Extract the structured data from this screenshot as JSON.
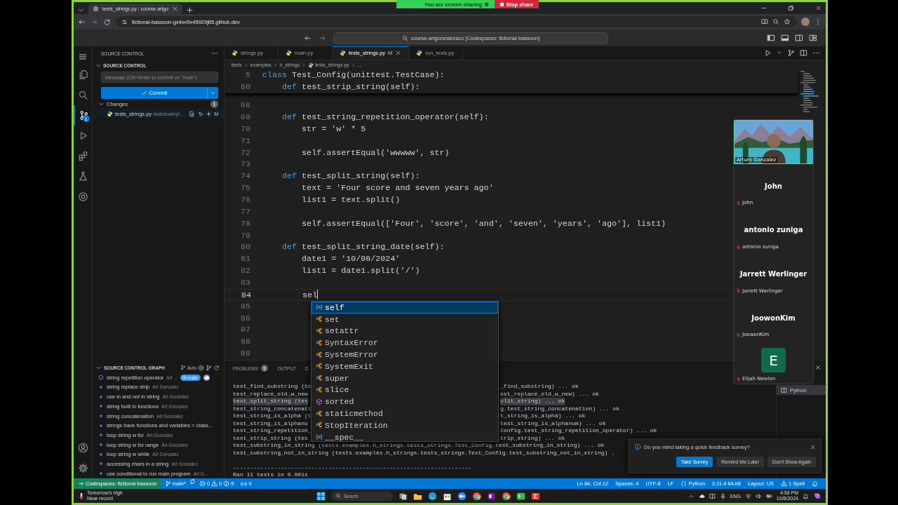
{
  "browser": {
    "tab_title": "tests_strings.py - course-artgo",
    "address": "fictional-bassoon-gx4xv9x45929j65.github.dev"
  },
  "share_bar": {
    "status": "You are screen sharing",
    "stop": "Stop share"
  },
  "title_bar": {
    "command_center": "course-artgonzalezacc [Codespaces: fictional bassoon]"
  },
  "activity_bar": {
    "items": [
      {
        "kind": "files",
        "selected": false
      },
      {
        "kind": "search",
        "selected": false
      },
      {
        "kind": "scm",
        "selected": true,
        "badge": "1"
      },
      {
        "kind": "run",
        "selected": false
      },
      {
        "kind": "extensions",
        "selected": false
      },
      {
        "kind": "testing",
        "selected": false
      },
      {
        "kind": "remote",
        "selected": false
      }
    ]
  },
  "sidebar": {
    "title": "SOURCE CONTROL",
    "section": {
      "label": "SOURCE CONTROL",
      "expanded": true
    },
    "message_placeholder": "Message (Ctrl+Enter to commit on \"main\")",
    "commit": "Commit",
    "changes": {
      "label": "Changes",
      "count": "1",
      "expanded": true,
      "files": [
        {
          "name": "tests_strings.py",
          "path": "tests/exampl...",
          "status": "M"
        }
      ]
    },
    "graph": {
      "label": "SOURCE CONTROL GRAPH",
      "expanded": true,
      "mode": "Auto",
      "commits": [
        {
          "message": "string repetition operator",
          "author": "Art ...",
          "branch": "main",
          "current": true
        },
        {
          "message": "string replace strip",
          "author": "Art Gonzalez",
          "current": false
        },
        {
          "message": "use in and not in string",
          "author": "Art Gonzalez",
          "current": false
        },
        {
          "message": "string built in functions",
          "author": "Art Gonzalez",
          "current": false
        },
        {
          "message": "string concatenation",
          "author": "Art Gonzalez",
          "current": false
        },
        {
          "message": "strings have functions and variables = class...",
          "current": false
        },
        {
          "message": "loop string w for",
          "author": "Art Gonzalez",
          "current": false
        },
        {
          "message": "loop string w for range",
          "author": "Art Gonzalez",
          "current": false
        },
        {
          "message": "loop string w while",
          "author": "Art Gonzalez",
          "current": false
        },
        {
          "message": "accessing chars in a string",
          "author": "Art Gonzalez",
          "current": false
        },
        {
          "message": "use conditional to run main program",
          "author": "Art G...",
          "current": false
        }
      ]
    }
  },
  "editor": {
    "tabs": [
      {
        "label": "strings.py",
        "selected": false
      },
      {
        "label": "main.py",
        "selected": false
      },
      {
        "label": "tests_strings.py",
        "status": "M",
        "selected": true
      },
      {
        "label": "run_tests.py",
        "selected": false
      }
    ],
    "breadcrumbs": [
      "tests",
      "examples",
      "h_strings",
      "tests_strings.py",
      "..."
    ],
    "sticky": [
      {
        "number": "5",
        "kind": "decl",
        "text": "class Test_Config(unittest.TestCase):"
      },
      {
        "number": "60",
        "kind": "decl",
        "text": "    def test_strip_string(self):"
      }
    ],
    "lines": [
      {
        "number": "68",
        "current": false
      },
      {
        "number": "69",
        "kind": "decl",
        "text": "    def test_string_repetition_operator(self):",
        "current": false
      },
      {
        "number": "70",
        "kind": "statement",
        "text": "        str = 'w' * 5",
        "current": false
      },
      {
        "number": "71",
        "current": false
      },
      {
        "number": "72",
        "kind": "statement",
        "text": "        self.assertEqual('wwwww', str)",
        "current": false
      },
      {
        "number": "73",
        "current": false
      },
      {
        "number": "74",
        "kind": "decl",
        "text": "    def test_split_string(self):",
        "current": false
      },
      {
        "number": "75",
        "kind": "statement",
        "text": "        text = 'Four score and seven years ago'",
        "current": false
      },
      {
        "number": "76",
        "kind": "statement",
        "text": "        list1 = text.split()",
        "current": false
      },
      {
        "number": "77",
        "current": false
      },
      {
        "number": "78",
        "kind": "statement",
        "text": "        self.assertEqual(['Four', 'score', 'and', 'seven', 'years', 'ago'], list1)",
        "current": false
      },
      {
        "number": "79",
        "current": false
      },
      {
        "number": "80",
        "kind": "decl",
        "text": "    def test_split_string_date(self):",
        "current": false
      },
      {
        "number": "81",
        "kind": "statement",
        "text": "        date1 = '10/08/2024'",
        "current": false
      },
      {
        "number": "82",
        "kind": "statement",
        "text": "        list1 = date1.split('/')",
        "current": false
      },
      {
        "number": "83",
        "current": false
      },
      {
        "number": "84",
        "kind": "statement",
        "text": "        sel",
        "current": true
      },
      {
        "number": "85",
        "current": false
      },
      {
        "number": "86",
        "current": false
      },
      {
        "number": "87",
        "current": false
      },
      {
        "number": "88",
        "current": false
      },
      {
        "number": "89",
        "current": false
      }
    ]
  },
  "suggest": {
    "items": [
      {
        "label": "self",
        "kind": "variable",
        "selected": true
      },
      {
        "label": "set",
        "kind": "class",
        "selected": false
      },
      {
        "label": "setattr",
        "kind": "class",
        "selected": false
      },
      {
        "label": "SyntaxError",
        "kind": "class",
        "selected": false
      },
      {
        "label": "SystemError",
        "kind": "class",
        "selected": false
      },
      {
        "label": "SystemExit",
        "kind": "class",
        "selected": false
      },
      {
        "label": "super",
        "kind": "class",
        "selected": false
      },
      {
        "label": "slice",
        "kind": "class",
        "selected": false
      },
      {
        "label": "sorted",
        "kind": "function",
        "selected": false
      },
      {
        "label": "staticmethod",
        "kind": "class",
        "selected": false
      },
      {
        "label": "StopIteration",
        "kind": "class",
        "selected": false
      },
      {
        "label": "__spec__",
        "kind": "variable",
        "selected": false
      }
    ]
  },
  "panel": {
    "tabs": [
      {
        "label": "PROBLEMS",
        "count": "5",
        "selected": false
      },
      {
        "label": "OUTPUT",
        "selected": false
      },
      {
        "label": "D",
        "selected": false
      }
    ],
    "output": [
      {
        "left": "test_find_substring (te",
        "right": "_find_substring) ... ok",
        "selected": false
      },
      {
        "left": "test_replace_old_w_new",
        "right": "est_replace_old_w_new) ... ok",
        "selected": false
      },
      {
        "left": "test_split_string (tes",
        "right": "plit_string) ... ok",
        "selected": true
      },
      {
        "left": "test_string_concatenati",
        "right": "g.test_string_concatenation) ... ok",
        "selected": false
      },
      {
        "left": "test_string_is_alpha (t",
        "right": "t_string_is_alpha) ... ok",
        "selected": false
      },
      {
        "left": "test_string_is_alphanu",
        "right": "test_string_is_alphanum) ... ok",
        "selected": false
      },
      {
        "left": "test_string_repetition_",
        "right": "Config.test_string_repetition_operator) ... ok",
        "selected": false
      },
      {
        "left": "test_strip_string (tes",
        "right": "trip_string) ... ok",
        "selected": false
      },
      {
        "text": "test_substring_in_string (tests.examples.h_strings.tests_strings.Test_Config.test_substring_in_string) ... ok",
        "selected": false
      },
      {
        "text": "test_substring_not_in_string (tests.examples.h_strings.tests_strings.Test_Config.test_substring_not_in_string) .",
        "selected": false
      },
      {
        "kind": "separator",
        "text": "----------------------------------------------------------------------",
        "selected": false
      },
      {
        "text": "Ran 11 tests in 0.001s",
        "selected": false
      }
    ],
    "terminals": [
      {
        "label": "Python",
        "selected": true
      }
    ]
  },
  "meeting": {
    "video_name": "Arturo Gonzalez",
    "participants": [
      {
        "kind": "name",
        "title": "John",
        "name": "John",
        "muted": true
      },
      {
        "kind": "name",
        "title": "antonio zuniga",
        "name": "antonio zuniga",
        "muted": true
      },
      {
        "kind": "name",
        "title": "Jarrett Werlinger",
        "name": "Jarrett Werlinger",
        "muted": true
      },
      {
        "kind": "name",
        "title": "JoowonKim",
        "name": "JoowonKim",
        "muted": true
      },
      {
        "kind": "avatar",
        "initial": "E",
        "name": "Elijah Newlon",
        "muted": true
      }
    ]
  },
  "toast": {
    "message": "Do you mind taking a quick feedback survey?",
    "buttons": [
      {
        "label": "Take Survey",
        "primary": true
      },
      {
        "label": "Remind Me Later",
        "primary": false
      },
      {
        "label": "Don't Show Again",
        "primary": false
      }
    ]
  },
  "status_bar": {
    "remote": "Codespaces: fictional bassoon",
    "branch": "main*",
    "errors": "0",
    "warnings": "0",
    "infos": "5",
    "ports": "0",
    "right": [
      {
        "kind": "text",
        "label": "Ln 84, Col 12"
      },
      {
        "kind": "text",
        "label": "Spaces: 4"
      },
      {
        "kind": "text",
        "label": "UTF-8"
      },
      {
        "kind": "text",
        "label": "LF"
      },
      {
        "kind": "language",
        "label": "Python"
      },
      {
        "kind": "text",
        "label": "3.11.4 64-bit"
      },
      {
        "kind": "text",
        "label": "Layout: US"
      },
      {
        "kind": "warning",
        "label": "1 Spell"
      },
      {
        "kind": "bell"
      }
    ]
  },
  "taskbar": {
    "weather": [
      "Tomorrow's high",
      "Near record"
    ],
    "search": "Search",
    "language": "ENG",
    "time": "4:56 PM",
    "date": "10/8/2024"
  }
}
